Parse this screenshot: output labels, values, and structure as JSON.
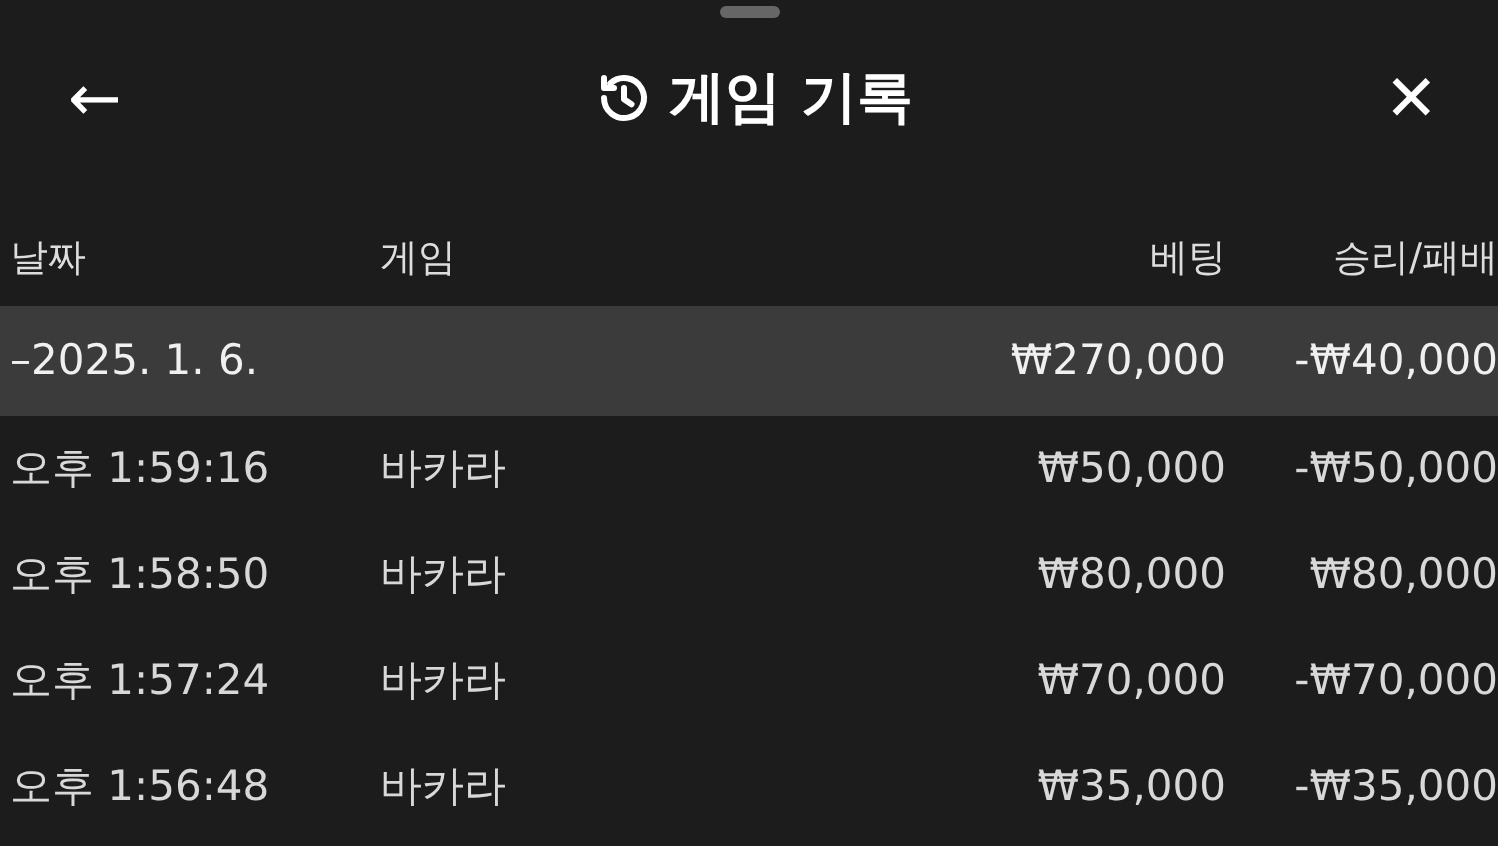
{
  "header": {
    "back": "←",
    "title": "게임 기록",
    "close": "✕"
  },
  "columns": [
    "날짜",
    "게임",
    "베팅",
    "승리/패배"
  ],
  "groups": [
    {
      "date": "–2025. 1. 6.",
      "bet": "₩270,000",
      "result": "-₩40,000",
      "rows": [
        {
          "time": "오후 1:59:16",
          "game": "바카라",
          "bet": "₩50,000",
          "result": "-₩50,000"
        },
        {
          "time": "오후 1:58:50",
          "game": "바카라",
          "bet": "₩80,000",
          "result": "₩80,000"
        },
        {
          "time": "오후 1:57:24",
          "game": "바카라",
          "bet": "₩70,000",
          "result": "-₩70,000"
        },
        {
          "time": "오후 1:56:48",
          "game": "바카라",
          "bet": "₩35,000",
          "result": "-₩35,000"
        }
      ]
    }
  ]
}
